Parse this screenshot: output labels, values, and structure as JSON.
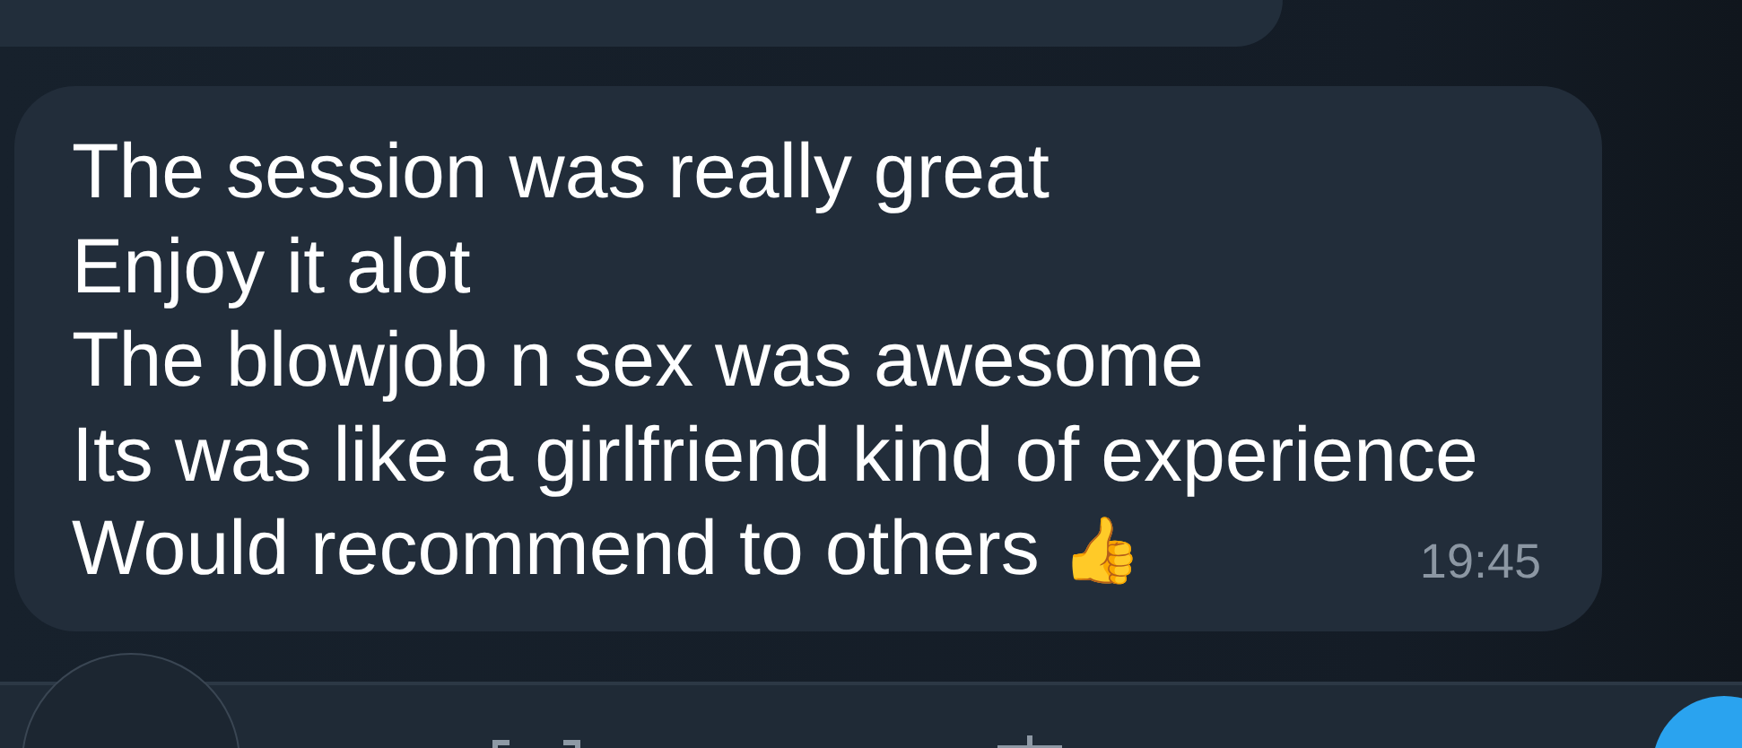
{
  "message": {
    "lines": [
      "The session was really great",
      "Enjoy it alot",
      "The blowjob n sex was awesome",
      "Its was like a girlfriend kind of experience",
      "Would recommend to others"
    ],
    "emoji": "👍",
    "time": "19:45"
  }
}
